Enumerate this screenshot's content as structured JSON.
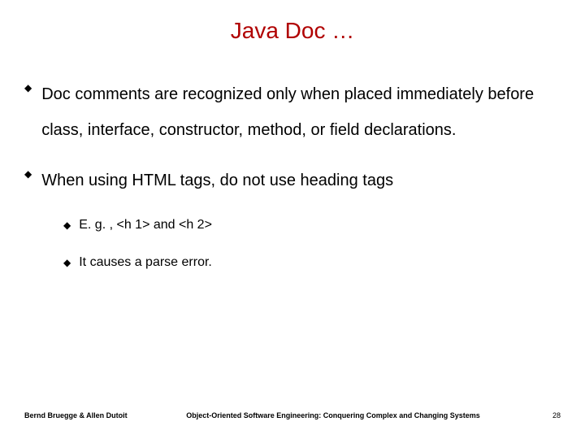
{
  "title": "Java Doc …",
  "bullets": [
    {
      "text": "Doc comments are recognized only when placed immediately before class, interface, constructor, method, or field declarations."
    },
    {
      "text": "When using HTML tags, do not use heading tags",
      "sub": [
        "E. g. , <h 1> and <h 2>",
        "It causes a parse error."
      ]
    }
  ],
  "footer": {
    "left": "Bernd Bruegge & Allen Dutoit",
    "center": "Object-Oriented Software Engineering: Conquering Complex and Changing Systems",
    "right": "28"
  }
}
